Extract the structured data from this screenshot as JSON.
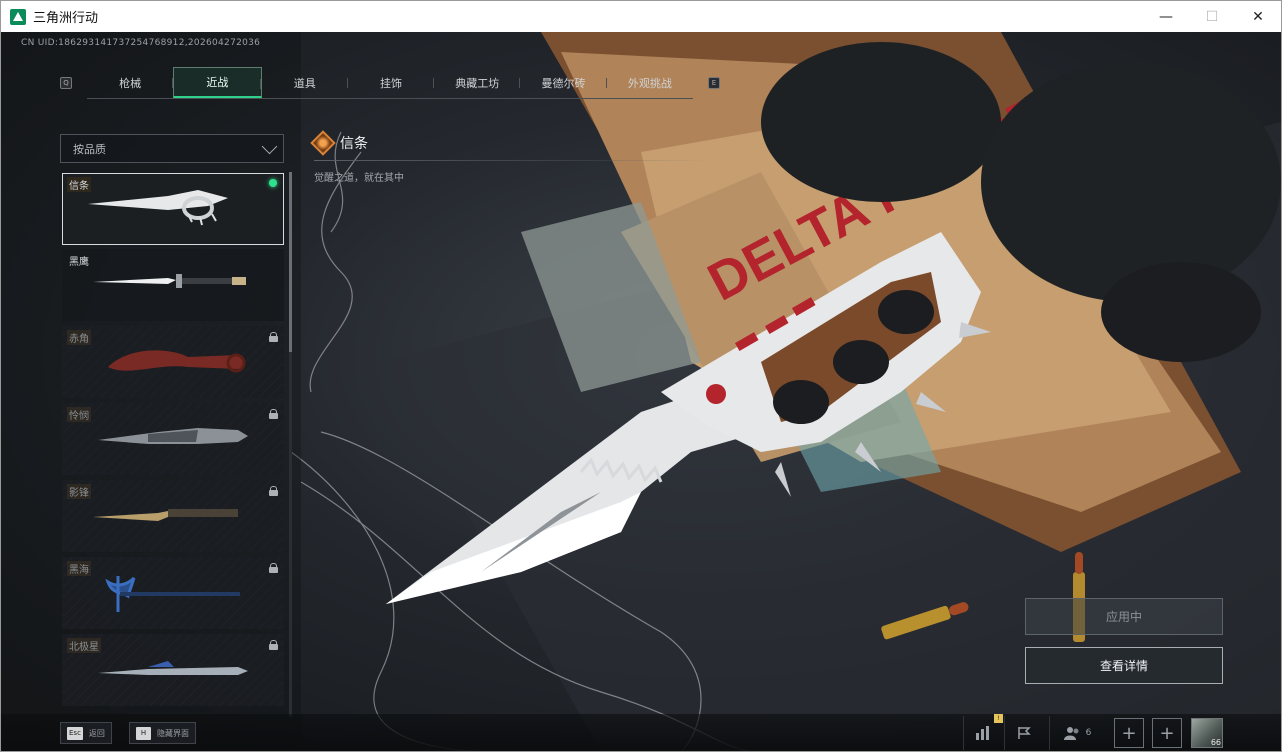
{
  "window": {
    "title": "三角洲行动",
    "minimize": "—",
    "maximize": "☐",
    "close": "✕"
  },
  "uid": "CN UID:18629314173725476891​2,202604272036",
  "tabs": {
    "prev_key": "Q",
    "next_key": "E",
    "items": [
      {
        "label": "枪械",
        "active": false
      },
      {
        "label": "近战",
        "active": true
      },
      {
        "label": "道具",
        "active": false
      },
      {
        "label": "挂饰",
        "active": false
      },
      {
        "label": "典藏工坊",
        "active": false
      },
      {
        "label": "曼德尔砖",
        "active": false
      },
      {
        "label": "外观挑战",
        "active": false
      }
    ]
  },
  "filter": {
    "label": "按品质"
  },
  "knife_list": [
    {
      "name": "信条",
      "state": "equipped"
    },
    {
      "name": "黑鹰",
      "state": "owned"
    },
    {
      "name": "赤角",
      "state": "locked"
    },
    {
      "name": "怜悯",
      "state": "locked"
    },
    {
      "name": "影锋",
      "state": "locked"
    },
    {
      "name": "黑海",
      "state": "locked"
    },
    {
      "name": "北极星",
      "state": "locked"
    }
  ],
  "selected": {
    "name": "信条",
    "description": "觉醒之道，就在其中"
  },
  "scene": {
    "poster_text": "DELTA FORCE",
    "tag_text": "DFT"
  },
  "actions": {
    "applied": "应用中",
    "detail": "查看详情"
  },
  "bottom": {
    "esc_key": "Esc",
    "esc_label": "返回",
    "h_key": "H",
    "h_label": "隐藏界面",
    "friends_count": "6",
    "stats_badge": "!",
    "avatar_level": "66"
  },
  "colors": {
    "accent": "#2fd28a",
    "blood": "#b3242d",
    "orange": "#d9843a"
  }
}
